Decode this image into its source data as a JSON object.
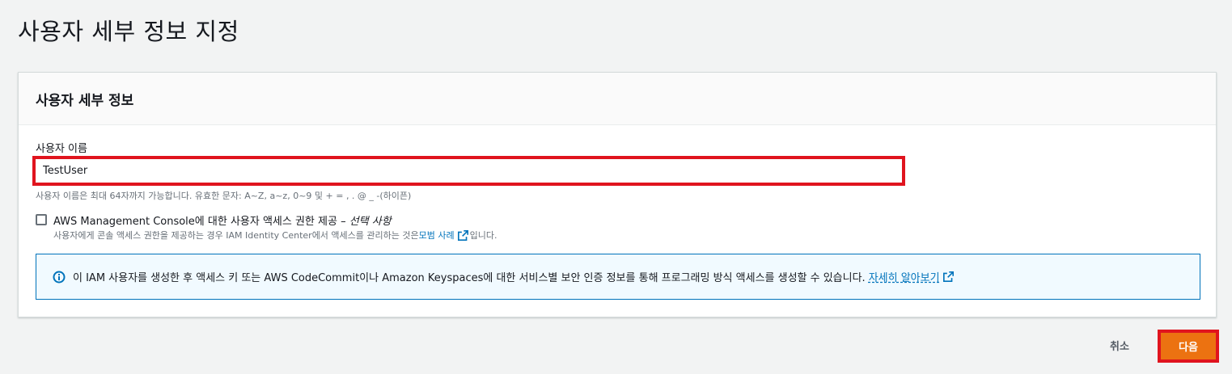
{
  "page": {
    "title": "사용자 세부 정보 지정"
  },
  "panel": {
    "header": "사용자 세부 정보",
    "username_label": "사용자 이름",
    "username_value": "TestUser",
    "username_hint": "사용자 이름은 최대 64자까지 가능합니다. 유효한 문자: A~Z, a~z, 0~9 및 + = , . @ _ -(하이픈)",
    "console_access": {
      "checked": false,
      "label": "AWS Management Console에 대한 사용자 액세스 권한 제공 – ",
      "optional": "선택 사항",
      "desc_prefix": "사용자에게 콘솔 액세스 권한을 제공하는 경우 IAM Identity Center에서 액세스를 관리하는 것은 ",
      "desc_link": "모범 사례",
      "desc_suffix": "입니다."
    },
    "info": {
      "text": "이 IAM 사용자를 생성한 후 액세스 키 또는 AWS CodeCommit이나 Amazon Keyspaces에 대한 서비스별 보안 인증 정보를 통해 프로그래밍 방식 액세스를 생성할 수 있습니다.",
      "link": "자세히 알아보기"
    }
  },
  "footer": {
    "cancel_label": "취소",
    "next_label": "다음"
  },
  "colors": {
    "primary": "#ec7211",
    "link": "#0073bb",
    "highlight": "#e0141e",
    "info_bg": "#f1faff"
  }
}
